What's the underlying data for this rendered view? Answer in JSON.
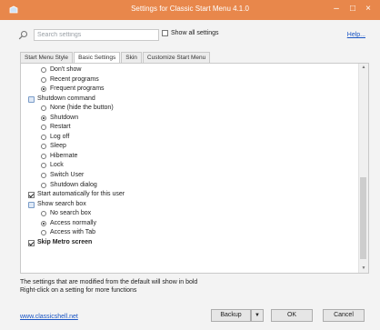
{
  "window": {
    "title": "Settings for Classic Start Menu 4.1.0"
  },
  "search": {
    "placeholder": "Search settings"
  },
  "show_all": {
    "label": "Show all settings",
    "checked": false
  },
  "help": {
    "label": "Help..."
  },
  "tabs": [
    {
      "label": "Start Menu Style",
      "active": false
    },
    {
      "label": "Basic Settings",
      "active": true
    },
    {
      "label": "Skin",
      "active": false
    },
    {
      "label": "Customize Start Menu",
      "active": false
    }
  ],
  "settings": [
    {
      "type": "radio",
      "label": "Don't show",
      "selected": false,
      "indent": 2,
      "name": "radio-dont-show"
    },
    {
      "type": "radio",
      "label": "Recent programs",
      "selected": false,
      "indent": 2,
      "name": "radio-recent-programs"
    },
    {
      "type": "radio",
      "label": "Frequent programs",
      "selected": true,
      "indent": 2,
      "name": "radio-frequent-programs"
    },
    {
      "type": "group",
      "label": "Shutdown command",
      "indent": 1,
      "name": "group-shutdown-command"
    },
    {
      "type": "radio",
      "label": "None (hide the button)",
      "selected": false,
      "indent": 2,
      "name": "radio-none"
    },
    {
      "type": "radio",
      "label": "Shutdown",
      "selected": true,
      "indent": 2,
      "name": "radio-shutdown"
    },
    {
      "type": "radio",
      "label": "Restart",
      "selected": false,
      "indent": 2,
      "name": "radio-restart"
    },
    {
      "type": "radio",
      "label": "Log off",
      "selected": false,
      "indent": 2,
      "name": "radio-log-off"
    },
    {
      "type": "radio",
      "label": "Sleep",
      "selected": false,
      "indent": 2,
      "name": "radio-sleep"
    },
    {
      "type": "radio",
      "label": "Hibernate",
      "selected": false,
      "indent": 2,
      "name": "radio-hibernate"
    },
    {
      "type": "radio",
      "label": "Lock",
      "selected": false,
      "indent": 2,
      "name": "radio-lock"
    },
    {
      "type": "radio",
      "label": "Switch User",
      "selected": false,
      "indent": 2,
      "name": "radio-switch-user"
    },
    {
      "type": "radio",
      "label": "Shutdown dialog",
      "selected": false,
      "indent": 2,
      "name": "radio-shutdown-dialog"
    },
    {
      "type": "checkbox",
      "label": "Start automatically for this user",
      "checked": true,
      "indent": 1,
      "name": "checkbox-start-automatically"
    },
    {
      "type": "group",
      "label": "Show search box",
      "indent": 1,
      "name": "group-show-search-box"
    },
    {
      "type": "radio",
      "label": "No search box",
      "selected": false,
      "indent": 2,
      "name": "radio-no-search-box"
    },
    {
      "type": "radio",
      "label": "Access normally",
      "selected": true,
      "indent": 2,
      "name": "radio-access-normally"
    },
    {
      "type": "radio",
      "label": "Access with Tab",
      "selected": false,
      "indent": 2,
      "name": "radio-access-with-tab"
    },
    {
      "type": "checkbox",
      "label": "Skip Metro screen",
      "checked": true,
      "indent": 1,
      "bold": true,
      "name": "checkbox-skip-metro-screen"
    }
  ],
  "footer": {
    "note_line1": "The settings that are modified from the default will show in bold",
    "note_line2": "Right-click on a setting for more functions",
    "link": "www.classicshell.net"
  },
  "buttons": {
    "backup": "Backup",
    "ok": "OK",
    "cancel": "Cancel"
  },
  "colors": {
    "titlebar": "#e8874b",
    "link": "#1a55c4"
  }
}
